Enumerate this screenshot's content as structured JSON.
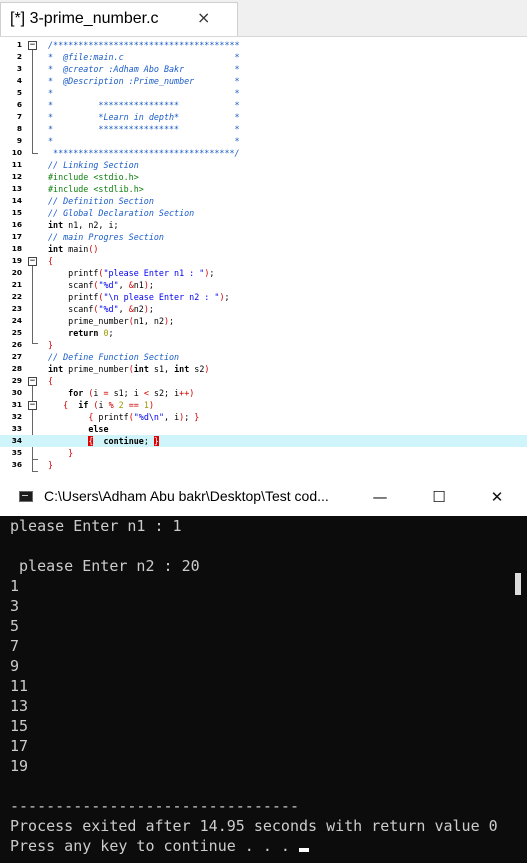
{
  "editor": {
    "tab_title": "[*] 3-prime_number.c",
    "tab_close": "×",
    "line_numbers": [
      "1",
      "2",
      "3",
      "4",
      "5",
      "6",
      "7",
      "8",
      "9",
      "10",
      "11",
      "12",
      "13",
      "14",
      "15",
      "16",
      "17",
      "18",
      "19",
      "20",
      "21",
      "22",
      "23",
      "24",
      "25",
      "26",
      "27",
      "28",
      "29",
      "30",
      "31",
      "32",
      "33",
      "34",
      "35",
      "36"
    ],
    "highlighted_line": "34"
  },
  "console": {
    "title": "C:\\Users\\Adham Abu bakr\\Desktop\\Test cod...",
    "minimize": "—",
    "maximize": "☐",
    "close": "✕",
    "lines": [
      "please Enter n1 : 1",
      "",
      " please Enter n2 : 20",
      "1",
      "3",
      "5",
      "7",
      "9",
      "11",
      "13",
      "15",
      "17",
      "19",
      "",
      "",
      "--------------------------------",
      "Process exited after 14.95 seconds with return value 0",
      "Press any key to continue . . . "
    ]
  },
  "colors": {
    "comment": "#1a5cc8",
    "preprocessor": "#108010",
    "string": "#0000ee",
    "operator": "#d00000",
    "number": "#9a9a00",
    "highlight": "#cff4fa",
    "console_bg": "#0c0c0c",
    "console_text": "#cccccc"
  }
}
